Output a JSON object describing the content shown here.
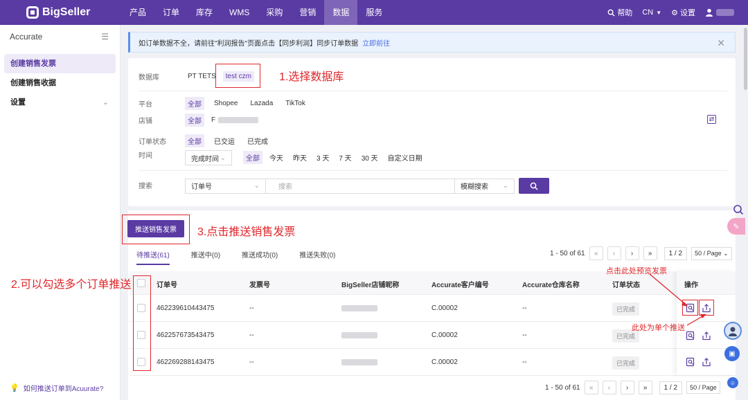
{
  "nav": {
    "logo": "BigSeller",
    "items": [
      "产品",
      "订单",
      "库存",
      "WMS",
      "采购",
      "营销",
      "数据",
      "服务"
    ],
    "help": "帮助",
    "lang": "CN",
    "settings": "设置"
  },
  "sidebar": {
    "title": "Accurate",
    "items": [
      {
        "label": "创建销售发票"
      },
      {
        "label": "创建销售收据"
      },
      {
        "label": "设置"
      }
    ],
    "footer": "如何推送订单到Acuurate?"
  },
  "alert": {
    "text": "如订单数据不全，请前往\"利润报告\"页面点击【同步利润】同步订单数据",
    "link": "立即前往"
  },
  "filters": {
    "database_label": "数据库",
    "databases": [
      "PT TETS",
      "test czm"
    ],
    "platform_label": "平台",
    "platforms": [
      "全部",
      "Shopee",
      "Lazada",
      "TikTok"
    ],
    "store_label": "店铺",
    "store_all": "全部",
    "store_first": "F",
    "status_label": "订单状态",
    "statuses": [
      "全部",
      "已交运",
      "已完成"
    ],
    "time_label": "时间",
    "time_type": "完成时间",
    "time_ranges": [
      "全部",
      "今天",
      "昨天",
      "3 天",
      "7 天",
      "30 天",
      "自定义日期"
    ],
    "search_label": "搜索",
    "search_field": "订单号",
    "search_placeholder": "搜索",
    "match_mode": "模糊搜索"
  },
  "annotations": {
    "step1": "1.选择数据库",
    "step2": "2.可以勾选多个订单推送",
    "step3": "3.点击推送销售发票",
    "preview": "点击此处预览发票",
    "single": "此处为单个推送"
  },
  "actions": {
    "push_button": "推送销售发票"
  },
  "tabs": [
    "待推送(61)",
    "推送中(0)",
    "推送成功(0)",
    "推送失败(0)"
  ],
  "pagination": {
    "range": "1 - 50 of 61",
    "page": "1 / 2",
    "page_size": "50 / Page"
  },
  "table": {
    "headers": [
      "订单号",
      "发票号",
      "BigSeller店铺昵称",
      "Accurate客户编号",
      "Accurate仓库名称",
      "订单状态",
      "操作"
    ],
    "rows": [
      {
        "order": "462239610443475",
        "invoice": "--",
        "customer": "C.00002",
        "warehouse": "--",
        "status": "已完成"
      },
      {
        "order": "462257673543475",
        "invoice": "--",
        "customer": "C.00002",
        "warehouse": "--",
        "status": "已完成"
      },
      {
        "order": "462269288143475",
        "invoice": "--",
        "customer": "C.00002",
        "warehouse": "--",
        "status": "已完成"
      }
    ]
  },
  "colors": {
    "brand": "#5a3aa3",
    "annotation": "#e0262b",
    "alert_bg": "#e9f2fd"
  }
}
